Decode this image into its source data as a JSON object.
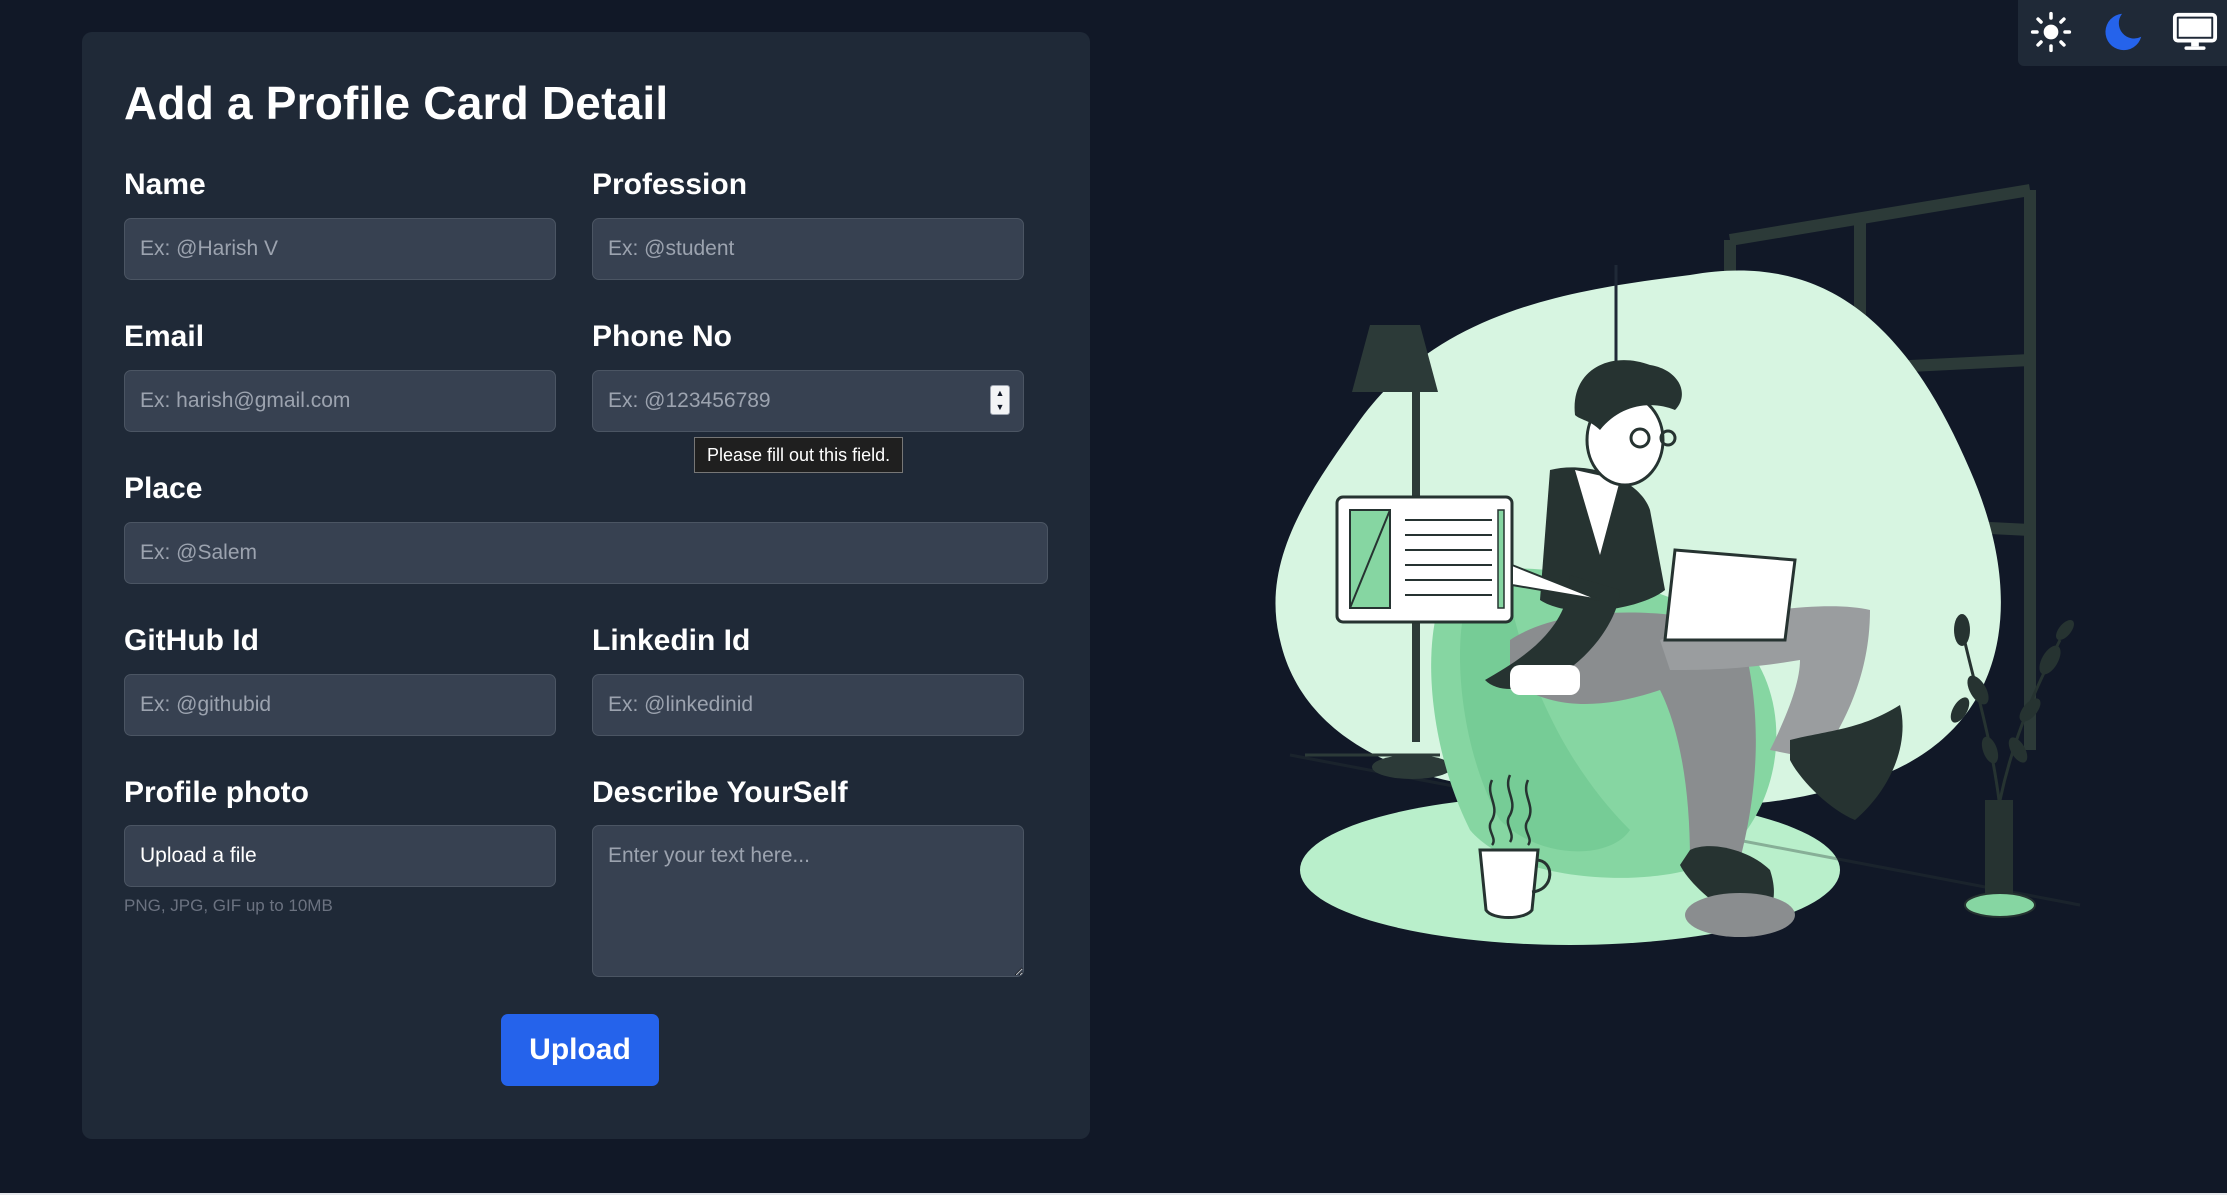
{
  "form": {
    "title": "Add a Profile Card Detail",
    "name": {
      "label": "Name",
      "placeholder": "Ex: @Harish V"
    },
    "profession": {
      "label": "Profession",
      "placeholder": "Ex: @student"
    },
    "email": {
      "label": "Email",
      "placeholder": "Ex: harish@gmail.com"
    },
    "phone": {
      "label": "Phone No",
      "placeholder": "Ex: @123456789",
      "validation_tooltip": "Please fill out this field."
    },
    "place": {
      "label": "Place",
      "placeholder": "Ex: @Salem"
    },
    "github": {
      "label": "GitHub Id",
      "placeholder": "Ex: @githubid"
    },
    "linkedin": {
      "label": "Linkedin Id",
      "placeholder": "Ex: @linkedinid"
    },
    "photo": {
      "label": "Profile photo",
      "button_label": "Upload a file",
      "hint": "PNG, JPG, GIF up to 10MB"
    },
    "describe": {
      "label": "Describe YourSelf",
      "placeholder": "Enter your text here..."
    },
    "submit_label": "Upload"
  },
  "theme_switcher": {
    "options": [
      {
        "icon": "sun-icon",
        "mode": "light",
        "active": false
      },
      {
        "icon": "moon-icon",
        "mode": "dark",
        "active": true
      },
      {
        "icon": "monitor-icon",
        "mode": "system",
        "active": false
      }
    ],
    "active_color": "#2563eb"
  },
  "colors": {
    "page_background": "#111827",
    "card_background": "#1f2937",
    "input_background": "#374151",
    "accent": "#2563eb",
    "illustration_green": "#d7f5e1"
  },
  "illustration": {
    "subject": "person-reading-laptop-in-beanbag"
  }
}
